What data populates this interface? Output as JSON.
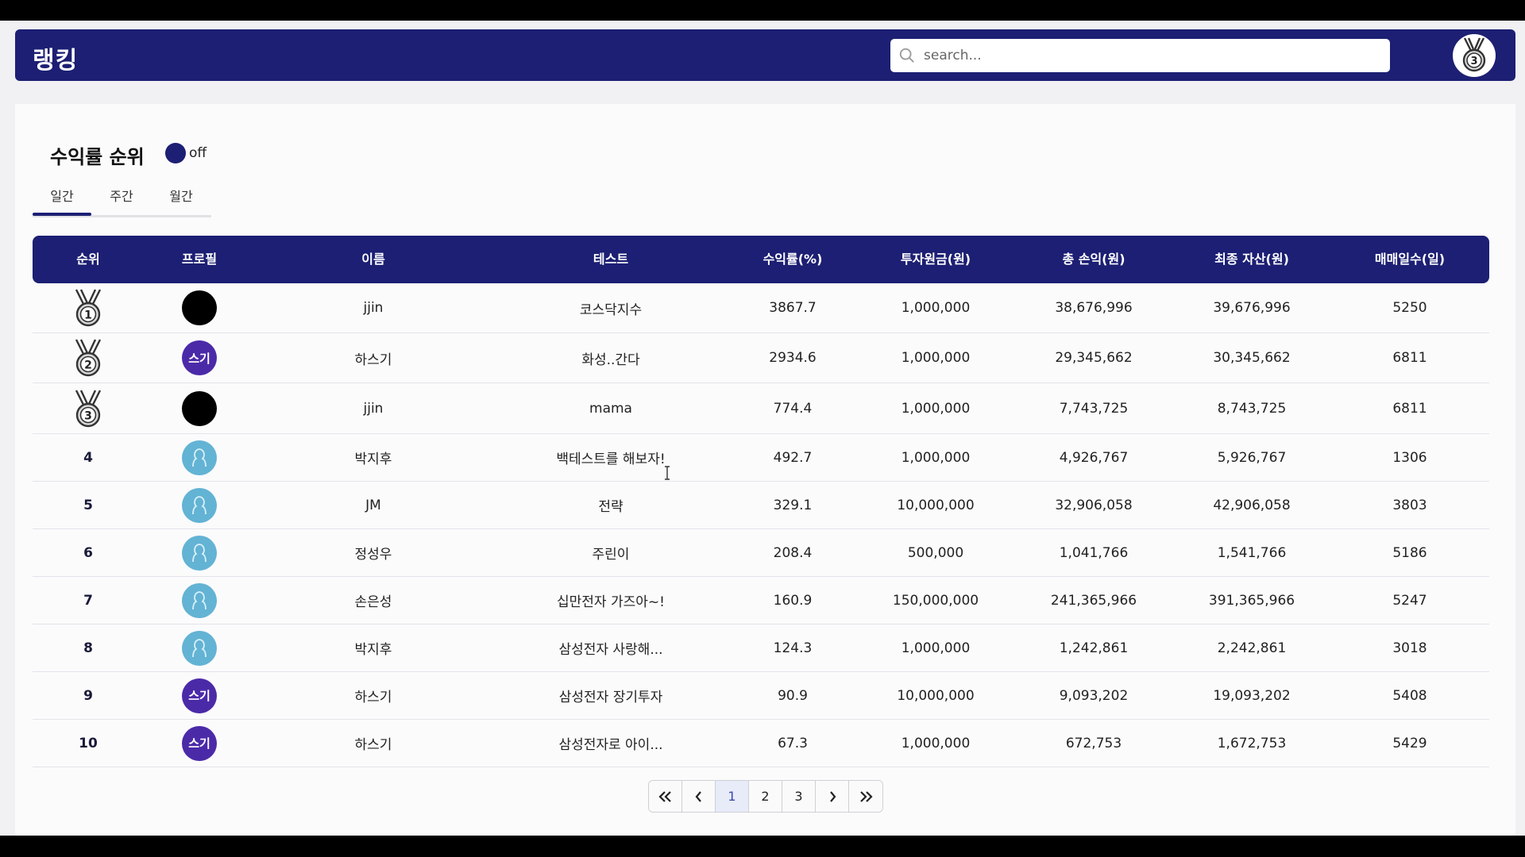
{
  "header": {
    "title": "랭킹",
    "search_placeholder": "search...",
    "search_value": ""
  },
  "section": {
    "title": "수익률 순위",
    "toggle_label": "off",
    "tabs": [
      "일간",
      "주간",
      "월간"
    ],
    "active_tab": "일간"
  },
  "table": {
    "columns": [
      "순위",
      "프로필",
      "이름",
      "테스트",
      "수익률(%)",
      "투자원금(원)",
      "총 손익(원)",
      "최종 자산(원)",
      "매매일수(일)"
    ],
    "rows": [
      {
        "rank": "1",
        "medal": true,
        "avatar": "black",
        "avatar_text": "",
        "name": "jjin",
        "test": "코스닥지수",
        "return": "3867.7",
        "principal": "1,000,000",
        "profit": "38,676,996",
        "final": "39,676,996",
        "days": "5250"
      },
      {
        "rank": "2",
        "medal": true,
        "avatar": "purple",
        "avatar_text": "스기",
        "name": "하스기",
        "test": "화성..간다",
        "return": "2934.6",
        "principal": "1,000,000",
        "profit": "29,345,662",
        "final": "30,345,662",
        "days": "6811"
      },
      {
        "rank": "3",
        "medal": true,
        "avatar": "black",
        "avatar_text": "",
        "name": "jjin",
        "test": "mama",
        "return": "774.4",
        "principal": "1,000,000",
        "profit": "7,743,725",
        "final": "8,743,725",
        "days": "6811"
      },
      {
        "rank": "4",
        "medal": false,
        "avatar": "default",
        "avatar_text": "",
        "name": "박지후",
        "test": "백테스트를 해보자!",
        "return": "492.7",
        "principal": "1,000,000",
        "profit": "4,926,767",
        "final": "5,926,767",
        "days": "1306"
      },
      {
        "rank": "5",
        "medal": false,
        "avatar": "default",
        "avatar_text": "",
        "name": "JM",
        "test": "전략",
        "return": "329.1",
        "principal": "10,000,000",
        "profit": "32,906,058",
        "final": "42,906,058",
        "days": "3803"
      },
      {
        "rank": "6",
        "medal": false,
        "avatar": "default",
        "avatar_text": "",
        "name": "정성우",
        "test": "주린이",
        "return": "208.4",
        "principal": "500,000",
        "profit": "1,041,766",
        "final": "1,541,766",
        "days": "5186"
      },
      {
        "rank": "7",
        "medal": false,
        "avatar": "default",
        "avatar_text": "",
        "name": "손은성",
        "test": "십만전자 가즈아~!",
        "return": "160.9",
        "principal": "150,000,000",
        "profit": "241,365,966",
        "final": "391,365,966",
        "days": "5247"
      },
      {
        "rank": "8",
        "medal": false,
        "avatar": "default",
        "avatar_text": "",
        "name": "박지후",
        "test": "삼성전자 사랑해...",
        "return": "124.3",
        "principal": "1,000,000",
        "profit": "1,242,861",
        "final": "2,242,861",
        "days": "3018"
      },
      {
        "rank": "9",
        "medal": false,
        "avatar": "purple",
        "avatar_text": "스기",
        "name": "하스기",
        "test": "삼성전자 장기투자",
        "return": "90.9",
        "principal": "10,000,000",
        "profit": "9,093,202",
        "final": "19,093,202",
        "days": "5408"
      },
      {
        "rank": "10",
        "medal": false,
        "avatar": "purple",
        "avatar_text": "스기",
        "name": "하스기",
        "test": "삼성전자로 아이...",
        "return": "67.3",
        "principal": "1,000,000",
        "profit": "672,753",
        "final": "1,672,753",
        "days": "5429"
      }
    ]
  },
  "pagination": {
    "pages": [
      "1",
      "2",
      "3"
    ],
    "current": "1",
    "first_icon": "double-chevron-left-icon",
    "prev_icon": "chevron-left-icon",
    "next_icon": "chevron-right-icon",
    "last_icon": "double-chevron-right-icon"
  },
  "colors": {
    "primary": "#1c1f73",
    "avatar_purple": "#4b2aa8",
    "avatar_default": "#63b3d4",
    "avatar_black": "#000000"
  }
}
